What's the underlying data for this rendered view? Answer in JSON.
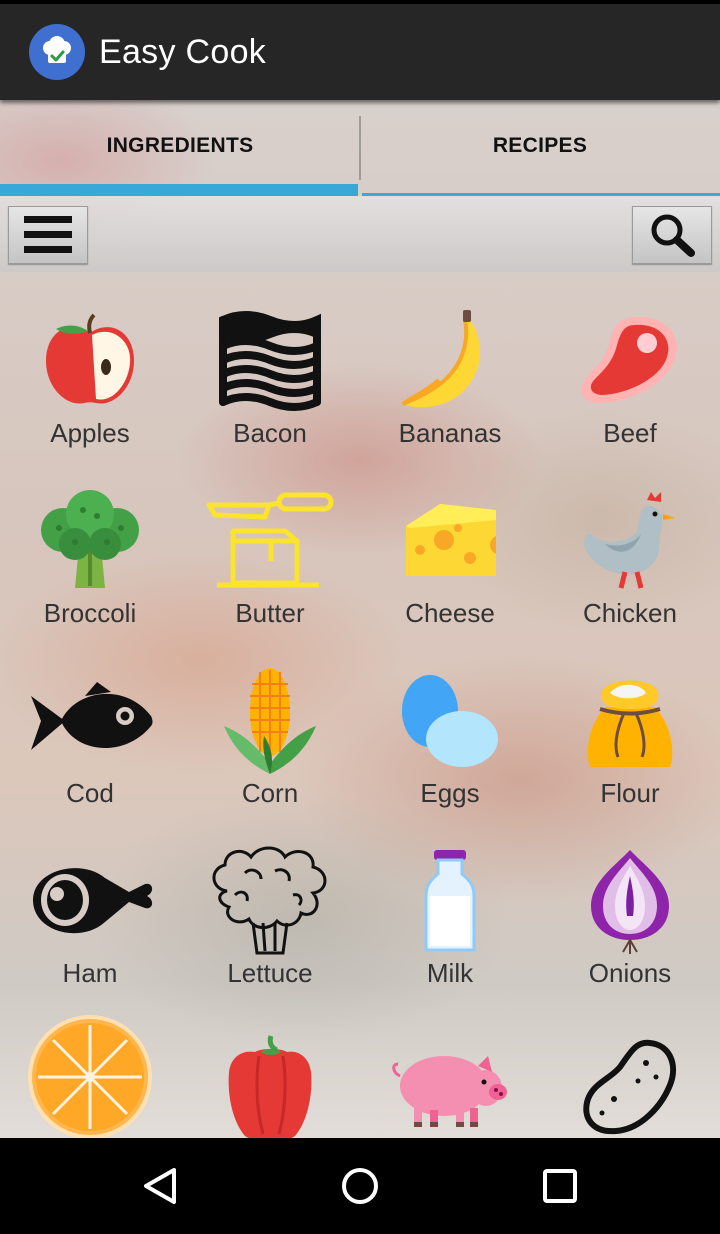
{
  "app": {
    "title": "Easy Cook"
  },
  "tabs": [
    {
      "label": "INGREDIENTS",
      "active": true
    },
    {
      "label": "RECIPES",
      "active": false
    }
  ],
  "toolbar": {
    "menu_icon": "hamburger-menu-icon",
    "search_icon": "search-icon"
  },
  "colors": {
    "accent": "#38a8d8",
    "action_bar": "#262626",
    "app_icon_bg": "#3f6fcf"
  },
  "ingredients": [
    {
      "label": "Apples",
      "icon": "apple-icon"
    },
    {
      "label": "Bacon",
      "icon": "bacon-icon"
    },
    {
      "label": "Bananas",
      "icon": "banana-icon"
    },
    {
      "label": "Beef",
      "icon": "beef-icon"
    },
    {
      "label": "Broccoli",
      "icon": "broccoli-icon"
    },
    {
      "label": "Butter",
      "icon": "butter-icon"
    },
    {
      "label": "Cheese",
      "icon": "cheese-icon"
    },
    {
      "label": "Chicken",
      "icon": "chicken-icon"
    },
    {
      "label": "Cod",
      "icon": "fish-icon"
    },
    {
      "label": "Corn",
      "icon": "corn-icon"
    },
    {
      "label": "Eggs",
      "icon": "eggs-icon"
    },
    {
      "label": "Flour",
      "icon": "flour-sack-icon"
    },
    {
      "label": "Ham",
      "icon": "ham-icon"
    },
    {
      "label": "Lettuce",
      "icon": "lettuce-icon"
    },
    {
      "label": "Milk",
      "icon": "milk-bottle-icon"
    },
    {
      "label": "Onions",
      "icon": "onion-icon"
    },
    {
      "label": "",
      "icon": "orange-icon"
    },
    {
      "label": "",
      "icon": "pepper-icon"
    },
    {
      "label": "",
      "icon": "pig-icon"
    },
    {
      "label": "",
      "icon": "potato-icon"
    }
  ],
  "navigation": {
    "back": "back-icon",
    "home": "home-icon",
    "recents": "recents-icon"
  }
}
